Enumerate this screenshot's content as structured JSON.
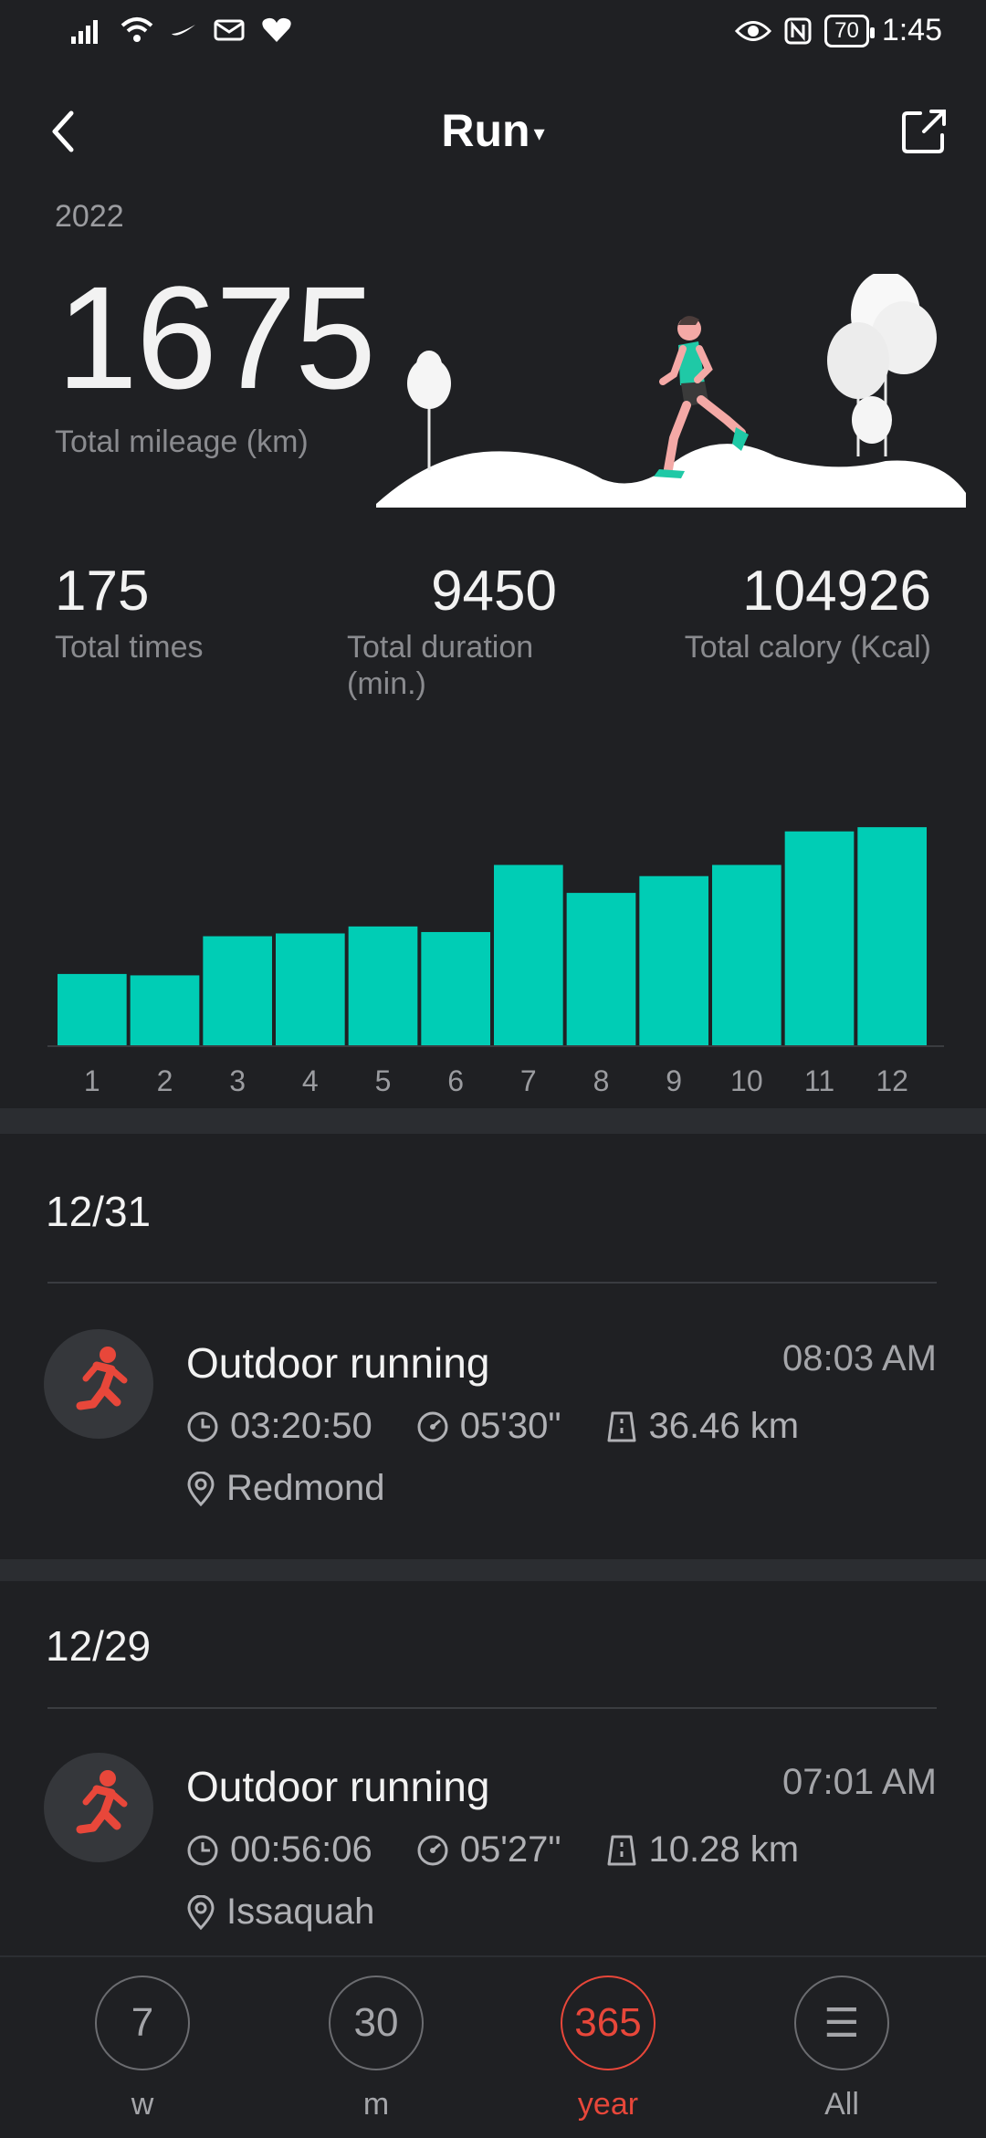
{
  "status_bar": {
    "time": "1:45",
    "battery": "70"
  },
  "header": {
    "title": "Run",
    "dropdown_caret": "▾"
  },
  "summary": {
    "year": "2022",
    "total_mileage": "1675",
    "total_mileage_label": "Total mileage (km)",
    "stats": [
      {
        "value": "175",
        "label": "Total times"
      },
      {
        "value": "9450",
        "label": "Total duration (min.)"
      },
      {
        "value": "104926",
        "label": "Total calory (Kcal)"
      }
    ]
  },
  "chart_data": {
    "type": "bar",
    "categories": [
      "1",
      "2",
      "3",
      "4",
      "5",
      "6",
      "7",
      "8",
      "9",
      "10",
      "11",
      "12"
    ],
    "values": [
      51,
      50,
      78,
      80,
      85,
      81,
      129,
      109,
      121,
      129,
      153,
      156
    ],
    "xlabel": "",
    "ylabel": "",
    "ylim": [
      0,
      160
    ],
    "color": "#00cdb5"
  },
  "activities": [
    {
      "date": "12/31",
      "title": "Outdoor running",
      "time": "08:03 AM",
      "duration": "03:20:50",
      "pace": "05'30\"",
      "distance": "36.46 km",
      "location": "Redmond"
    },
    {
      "date": "12/29",
      "title": "Outdoor running",
      "time": "07:01 AM",
      "duration": "00:56:06",
      "pace": "05'27\"",
      "distance": "10.28 km",
      "location": "Issaquah"
    }
  ],
  "bottom_nav": [
    {
      "icon_text": "7",
      "label": "w"
    },
    {
      "icon_text": "30",
      "label": "m"
    },
    {
      "icon_text": "365",
      "label": "year",
      "active": true
    },
    {
      "icon_text": "☰",
      "label": "All"
    }
  ],
  "colors": {
    "accent": "#e8473a",
    "bar": "#00cdb5",
    "background": "#1f2023"
  }
}
